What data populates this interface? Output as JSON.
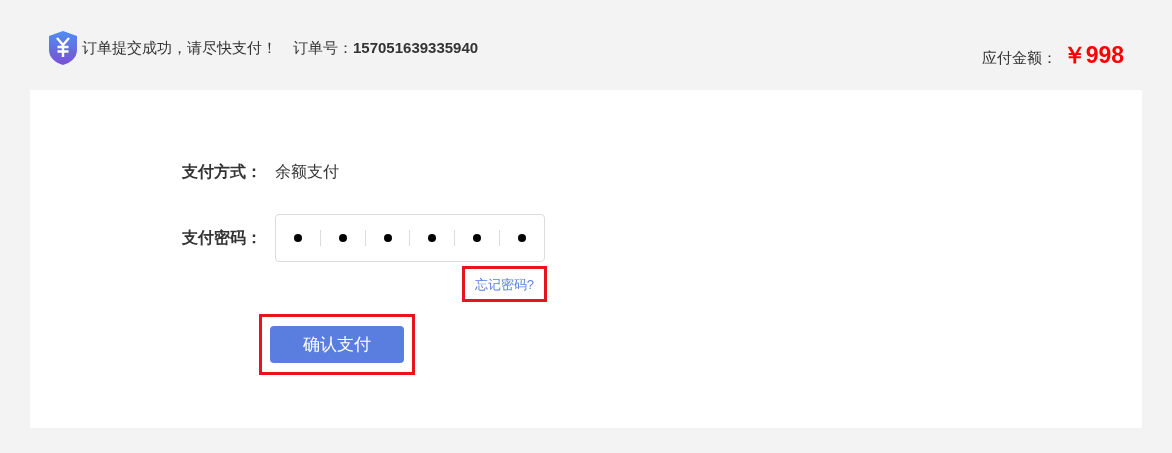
{
  "header": {
    "message": "订单提交成功，请尽快支付！",
    "order_label": "订单号：",
    "order_number": "157051639335940",
    "amount_label": "应付金额：",
    "amount": "￥998"
  },
  "form": {
    "method_label": "支付方式：",
    "method_value": "余额支付",
    "password_label": "支付密码：",
    "pin_cells": [
      {
        "filled": true
      },
      {
        "filled": true
      },
      {
        "filled": true
      },
      {
        "filled": true
      },
      {
        "filled": true
      },
      {
        "filled": true
      }
    ],
    "forgot_link": {
      "label": "忘记密码?",
      "highlighted": true
    },
    "submit_button": {
      "label": "确认支付",
      "highlighted": true
    }
  }
}
